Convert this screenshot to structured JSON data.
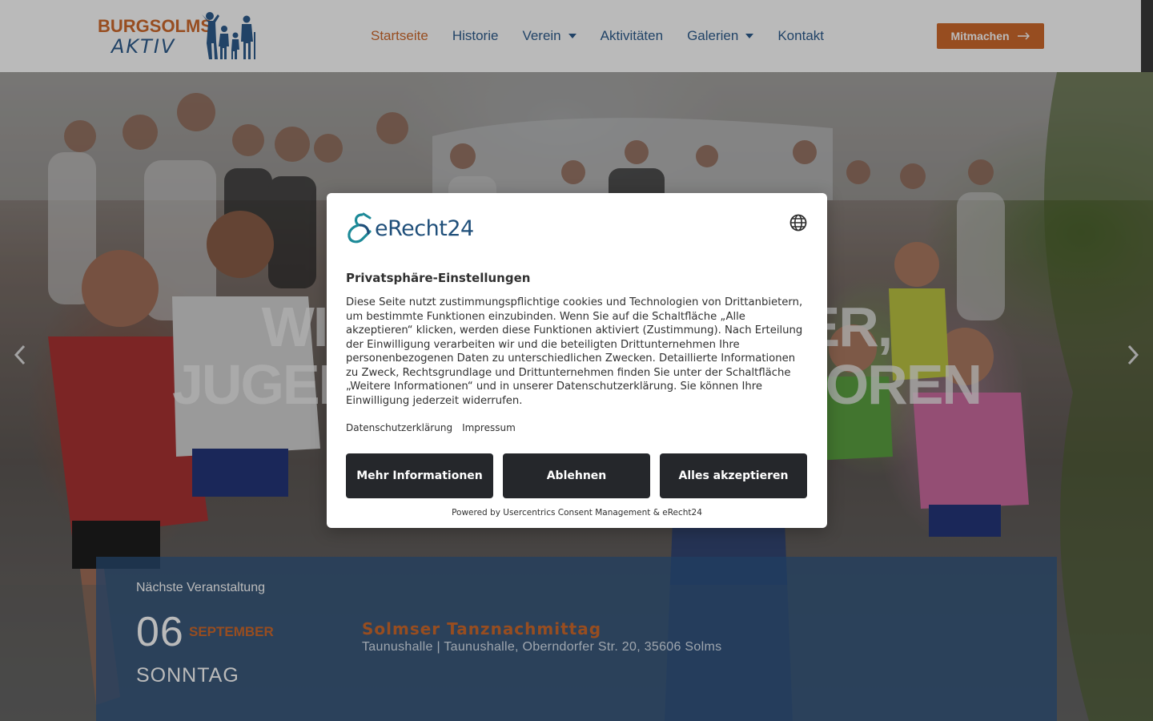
{
  "header": {
    "logo": {
      "line1": "BURGSOLMS",
      "line2": "AKTIV",
      "icon": "family-silhouette-icon"
    },
    "nav": [
      {
        "label": "Startseite",
        "active": true,
        "has_dropdown": false
      },
      {
        "label": "Historie",
        "active": false,
        "has_dropdown": false
      },
      {
        "label": "Verein",
        "active": false,
        "has_dropdown": true
      },
      {
        "label": "Aktivitäten",
        "active": false,
        "has_dropdown": false
      },
      {
        "label": "Galerien",
        "active": false,
        "has_dropdown": true
      },
      {
        "label": "Kontakt",
        "active": false,
        "has_dropdown": false
      }
    ],
    "cta_label": "Mitmachen"
  },
  "hero": {
    "title_line1": "WIR BEWEGEN KINDER,",
    "title_line2": "JUGENDLICHE UND SENIOREN",
    "arrows": [
      "chevron-left-icon",
      "chevron-right-icon"
    ]
  },
  "event": {
    "kicker": "Nächste Veranstaltung",
    "day": "06",
    "month": "SEPTEMBER",
    "weekday": "SONNTAG",
    "title": "Solmser Tanznachmittag",
    "location": "Taunushalle | Taunushalle, Oberndorfer Str. 20, 35606 Solms"
  },
  "consent": {
    "brand": "eRecht24",
    "language_icon": "globe-icon",
    "title": "Privatsphäre-Einstellungen",
    "body": "Diese Seite nutzt zustimmungspflichtige cookies und Technologien von Drittanbietern, um bestimmte Funktionen einzubinden. Wenn Sie auf die Schaltfläche „Alle akzeptieren“ klicken, werden diese Funktionen aktiviert (Zustimmung). Nach Erteilung der Einwilligung verarbeiten wir und die beteiligten Drittunternehmen Ihre personenbezogenen Daten zu unterschiedlichen Zwecken. Detaillierte Informationen zu Zweck, Rechtsgrundlage und Drittunternehmen finden Sie unter der Schaltfläche „Weitere Informationen“ und in unserer Datenschutzerklärung. Sie können Ihre Einwilligung jederzeit widerrufen.",
    "links": [
      "Datenschutzerklärung",
      "Impressum"
    ],
    "buttons": {
      "more": "Mehr Informationen",
      "deny": "Ablehnen",
      "accept": "Alles akzeptieren"
    },
    "powered_by": "Powered by Usercentrics Consent Management & eRecht24"
  },
  "colors": {
    "brand_orange": "#d06a2c",
    "brand_blue": "#2e5d8e",
    "event_box": "#2d5687",
    "button_dark": "#25272b"
  }
}
